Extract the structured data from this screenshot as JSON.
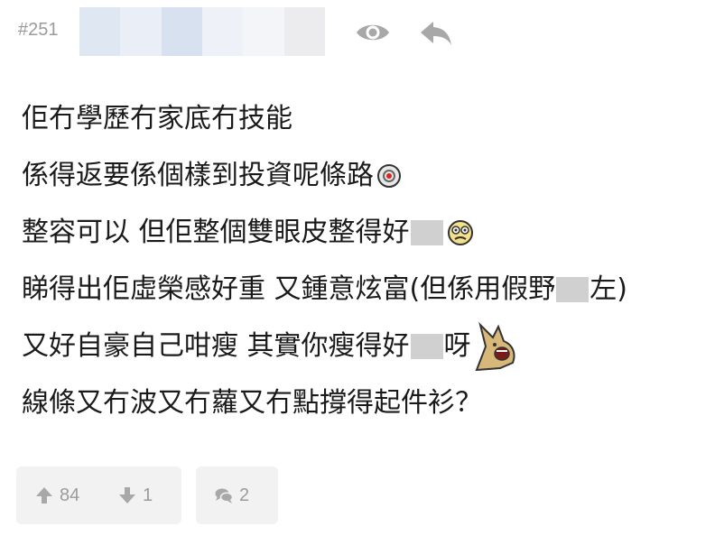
{
  "post": {
    "number": "#251"
  },
  "body_lines": [
    {
      "text": "佢冇學歷冇家底冇技能"
    },
    {
      "text": "係得返要係個樣到投資呢條路"
    },
    {
      "before": "整容可以 但佢整個雙眼皮整得好"
    },
    {
      "before": "睇得出佢虛榮感好重 又鍾意炫富(但係用假野",
      "after": "左)"
    },
    {
      "before": "又好自豪自己咁瘦 其實你瘦得好",
      "after": "呀"
    },
    {
      "text": "線條又冇波又冇蘿又冇點撐得起件衫？"
    }
  ],
  "actions": {
    "upvotes": "84",
    "downvotes": "1",
    "comments": "2"
  },
  "icons": {
    "view": "eye-icon",
    "reply": "reply-arrow-icon",
    "upvote": "arrow-up-icon",
    "downvote": "arrow-down-icon",
    "comment": "speech-bubbles-icon"
  },
  "colors": {
    "muted_text": "#9b9b9b",
    "icon": "#a8a8a8",
    "action_bg": "#f2f2f2",
    "censor_block": "#d0d0d0"
  }
}
